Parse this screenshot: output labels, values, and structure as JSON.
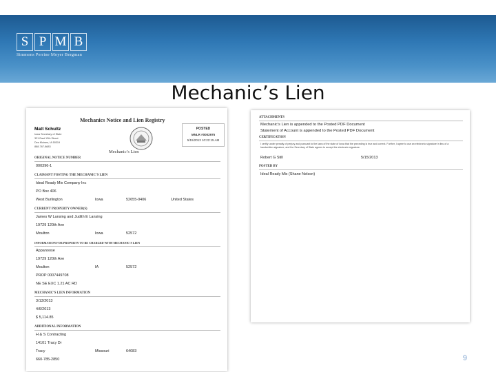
{
  "slide": {
    "logo_letters": [
      "S",
      "P",
      "M",
      "B"
    ],
    "logo_subtitle": "Simmons Perrine Moyer Bergman",
    "title": "Mechanic’s Lien",
    "page_number": "9"
  },
  "doc1": {
    "heading": "Mechanics Notice and Lien Registry",
    "subheading": "Mechanic’s Lien",
    "filer_name": "Matt Schultz",
    "filer_lines": [
      "Iowa Secretary of State",
      "321 East 12th Street",
      "Des Moines, IA 50319",
      "888-767-8683"
    ],
    "posted_label": "POSTED",
    "posted_id": "MNLR #0002975",
    "posted_date": "5/15/2013 10:22:15 AM",
    "sections": [
      {
        "title": "Original Notice Number",
        "rows": [
          [
            "000396-1"
          ]
        ]
      },
      {
        "title": "Claimant Posting the Mechanic’s Lien",
        "rows": [
          [
            "Ideal Ready Mix Company Inc"
          ],
          [
            "PO Box 406"
          ],
          [
            "West Burlington",
            "Iowa",
            "52655-0406",
            "United States"
          ]
        ]
      },
      {
        "title": "Current Property Owner(s)",
        "rows": [
          [
            "James W Lansing and Judith E Lansing"
          ],
          [
            "19729 120th Ave"
          ],
          [
            "Moulton",
            "Iowa",
            "52572"
          ]
        ]
      },
      {
        "title": "Information for Property to be Charged with Mechanic’s Lien",
        "rows": [
          [
            "Appanoose"
          ],
          [
            "19729 120th Ave"
          ],
          [
            "Moulton",
            "IA",
            "52572"
          ],
          [
            "PROP 0007449708"
          ],
          [
            "NE SE EXC 1.21 AC RD"
          ]
        ]
      },
      {
        "title": "Mechanic’s Lien Information",
        "rows": [
          [
            "3/13/2013"
          ],
          [
            "4/6/2013"
          ],
          [
            "$ 5,114.85"
          ]
        ]
      },
      {
        "title": "Additional Information",
        "rows": [
          [
            "H & S Contracting"
          ],
          [
            "14101 Tracy Dr"
          ],
          [
            "Tracy",
            "Missouri",
            "64083"
          ],
          [
            "660-785-2850"
          ]
        ]
      }
    ]
  },
  "doc2": {
    "attachments_title": "Attachments",
    "attachments": [
      "Mechanic’s Lien is appended to the Posted PDF Document",
      "Statement of Account is appended to the Posted PDF Document"
    ],
    "certification_title": "Certification",
    "certification_text": "I certify under penalty of perjury and pursuant to the laws of the state of Iowa that the preceding is true and correct. Further, I agree to use an electronic signature in lieu of a handwritten signature, and the Secretary of State agrees to accept the electronic signature.",
    "signer": "Robert G Still",
    "sign_date": "5/15/2013",
    "posted_by_title": "Posted By",
    "posted_by": "Ideal Ready Mix (Shane Nelson)"
  }
}
